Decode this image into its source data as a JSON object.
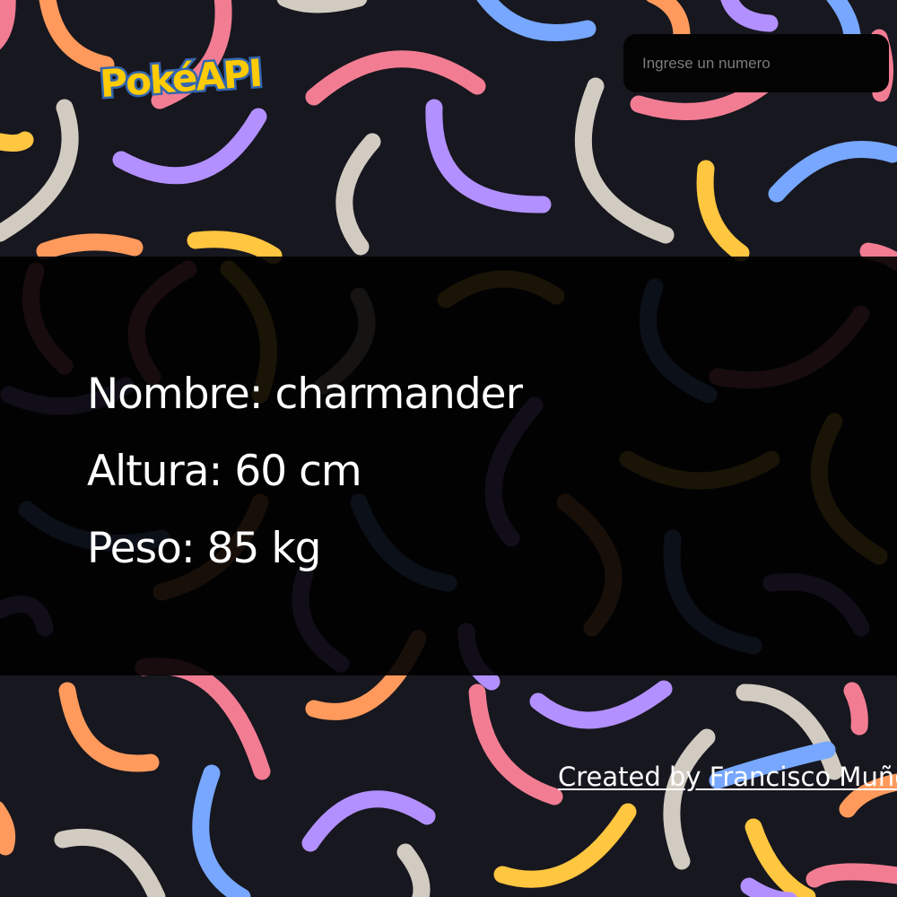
{
  "header": {
    "logo_text": "PokéAPI",
    "search": {
      "placeholder": "Ingrese un numero",
      "value": ""
    }
  },
  "pokemon": {
    "name_line": "Nombre: charmander",
    "height_line": "Altura: 60 cm",
    "weight_line": "Peso: 85 kg"
  },
  "footer": {
    "credit_text": "Created by Francisco Muñoz"
  },
  "colors": {
    "background": "#17171f",
    "band": "#000000",
    "pink": "#f27d93",
    "orange": "#ff9a5c",
    "purple": "#b290ff",
    "blue": "#77a7ff",
    "beige": "#d2cbc1",
    "yellow": "#ffc640",
    "logo_yellow": "#ffcb05",
    "logo_blue": "#3466af"
  }
}
